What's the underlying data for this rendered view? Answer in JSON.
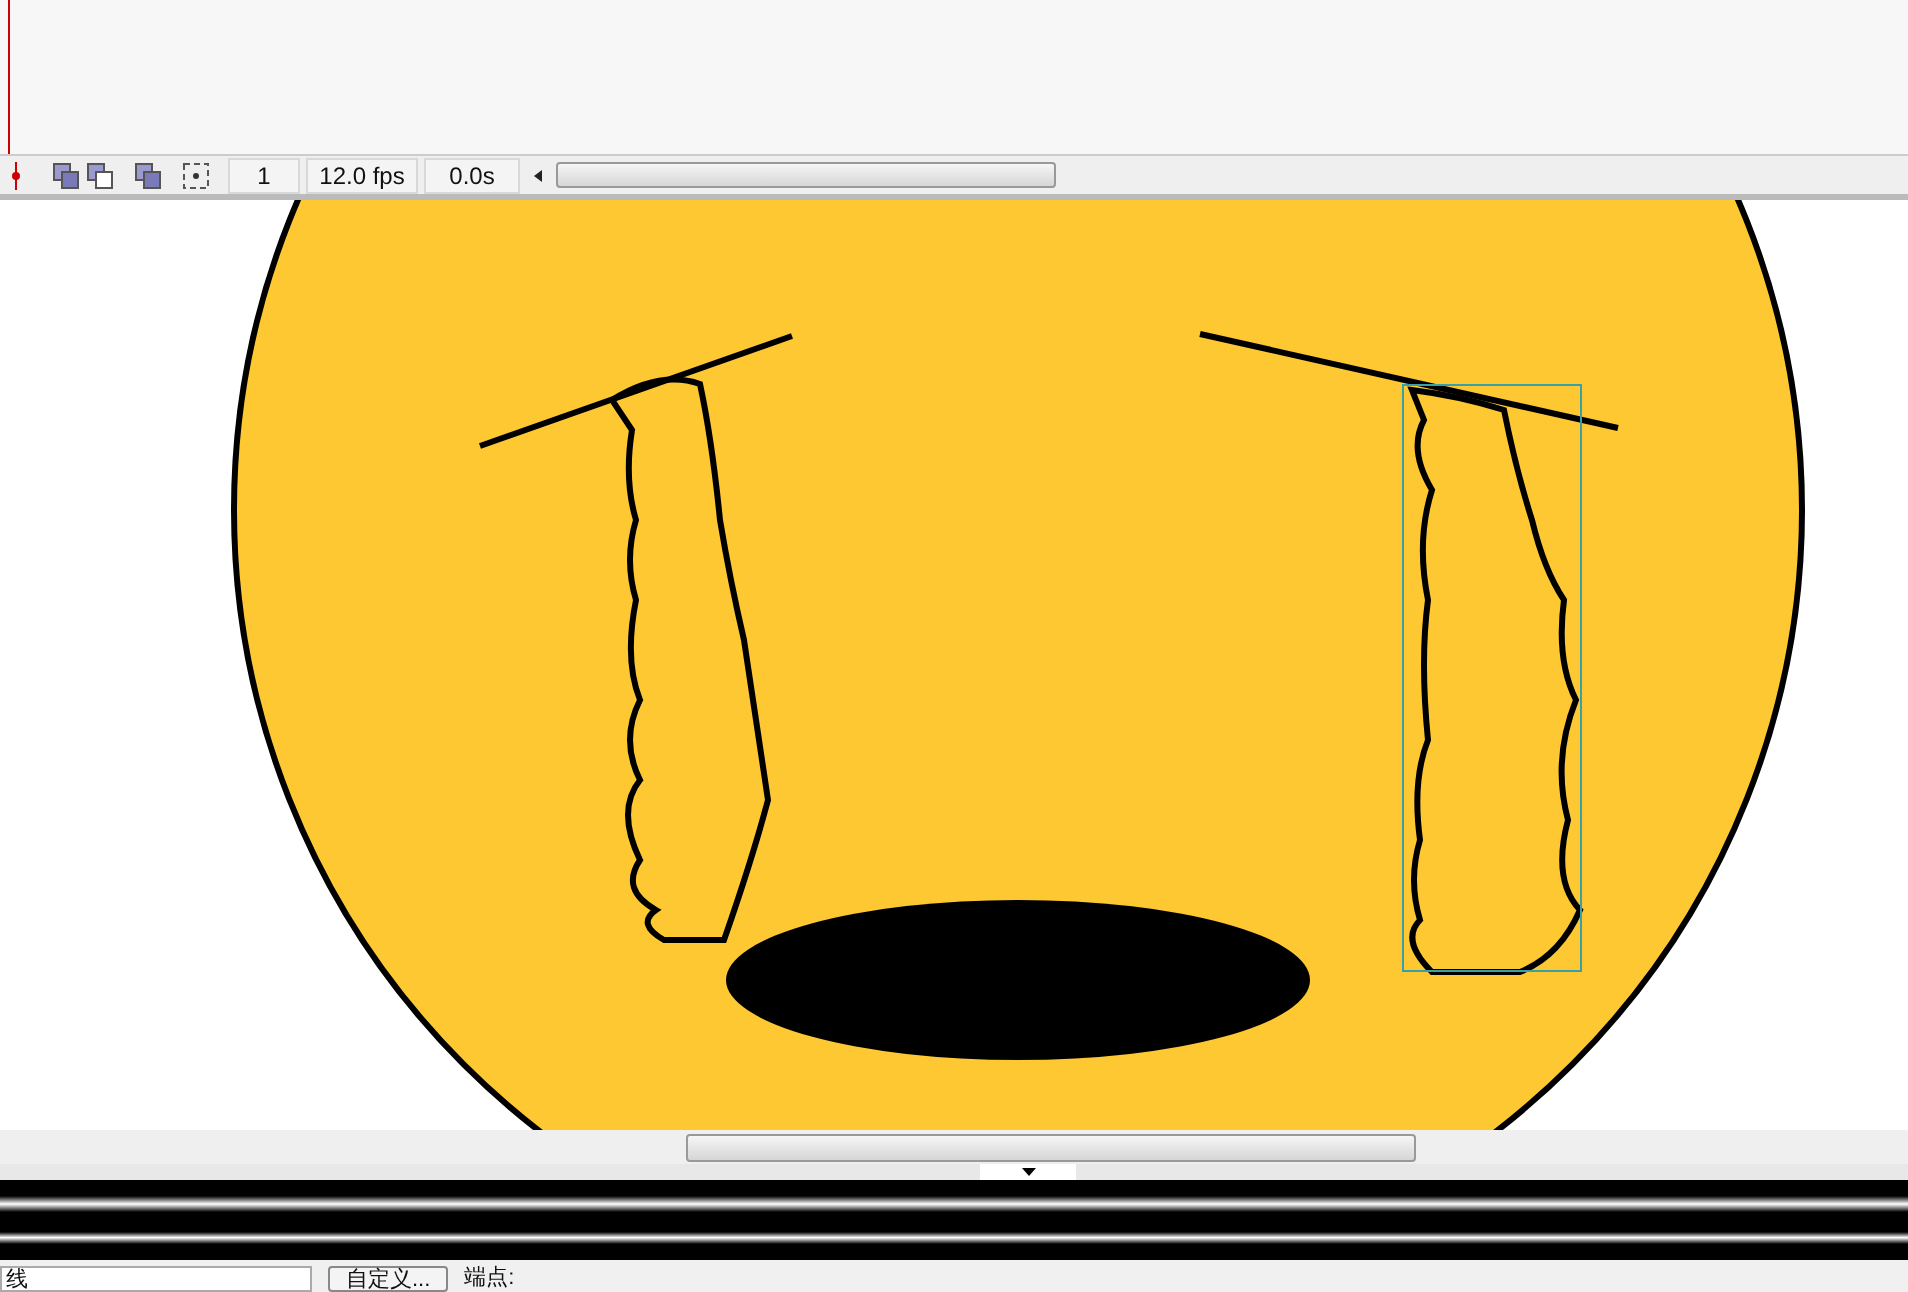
{
  "timeline_status": {
    "frame": "1",
    "fps": "12.0 fps",
    "time": "0.0s"
  },
  "properties": {
    "stroke_style": "线",
    "custom_button": "自定义...",
    "cap_label": "端点:"
  }
}
